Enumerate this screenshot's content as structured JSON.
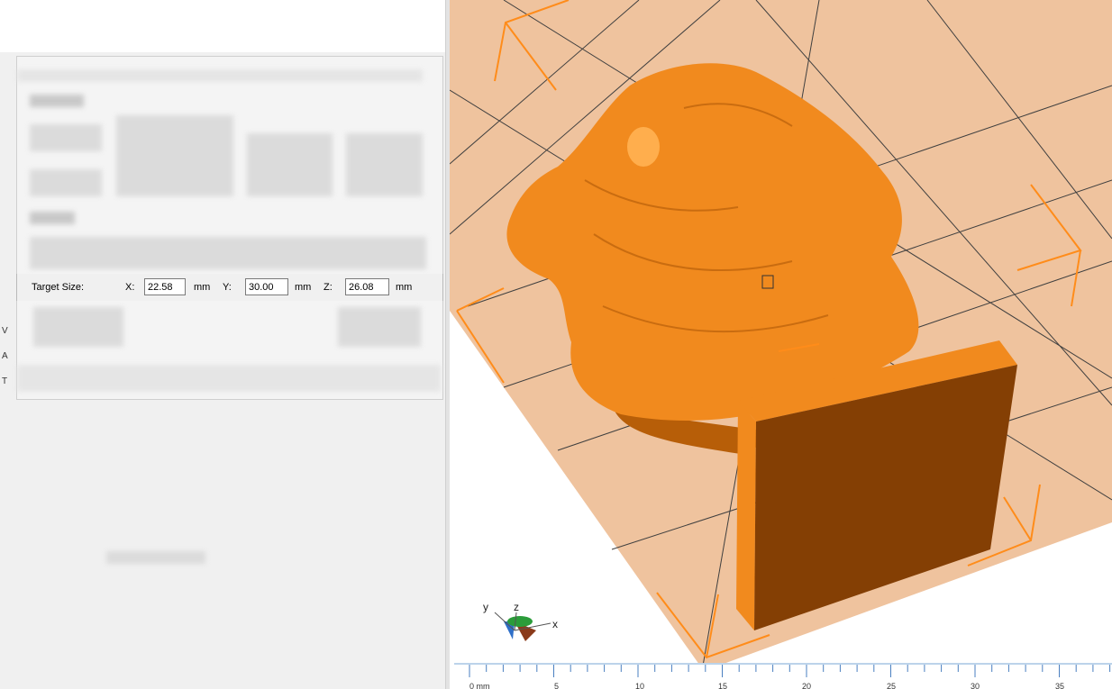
{
  "scale_dialog": {
    "target_size_label": "Target Size:",
    "x_label": "X:",
    "x_value": "22.58",
    "x_unit": "mm",
    "y_label": "Y:",
    "y_value": "30.00",
    "y_unit": "mm",
    "z_label": "Z:",
    "z_value": "26.08",
    "z_unit": "mm"
  },
  "left_edge_letters": [
    "V",
    "A",
    "T"
  ],
  "axis_gizmo": {
    "x": "x",
    "y": "y",
    "z": "z"
  },
  "ruler": {
    "unit_label": "0 mm",
    "ticks": [
      "5",
      "10",
      "15",
      "20",
      "25",
      "30",
      "35"
    ]
  },
  "colors": {
    "bed": "#efc39e",
    "grid_line": "#3f3f3f",
    "model": "#f18a1e",
    "model_shadow": "#b75e08",
    "stand_face": "#843f04",
    "corner_markers": "#ff8c1a",
    "panel_bg": "#f0f0f0"
  }
}
